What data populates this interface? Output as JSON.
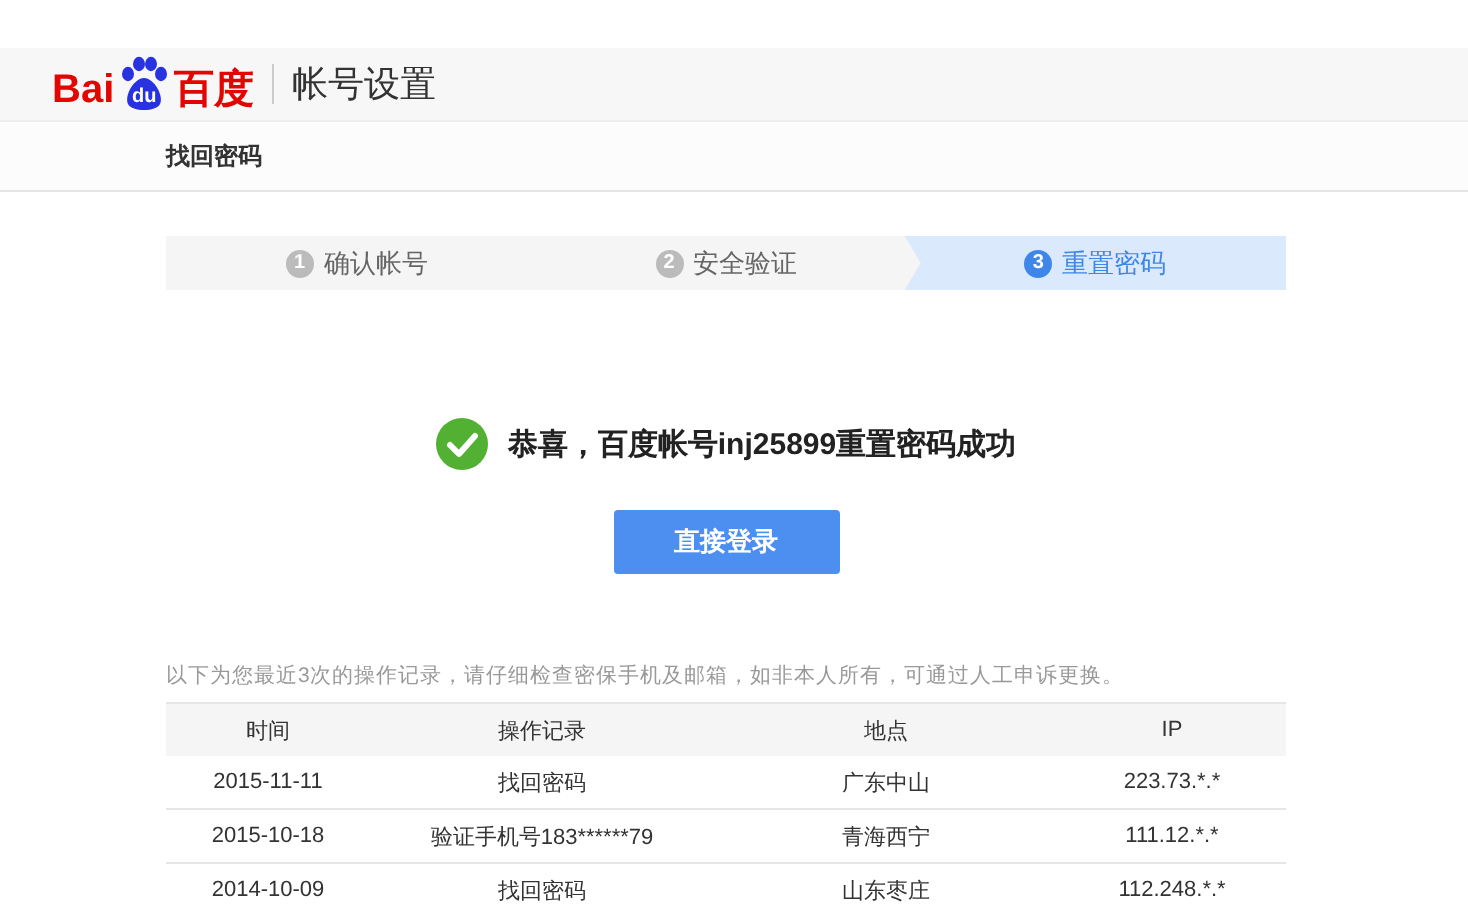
{
  "logo": {
    "left": "Bai",
    "paw": "du",
    "right": "百度"
  },
  "header": {
    "title": "帐号设置"
  },
  "breadcrumb": "找回密码",
  "steps": [
    {
      "number": "1",
      "label": "确认帐号",
      "selected": false
    },
    {
      "number": "2",
      "label": "安全验证",
      "selected": false
    },
    {
      "number": "3",
      "label": "重置密码",
      "selected": true
    }
  ],
  "message": {
    "before": "恭喜，百度帐号",
    "account": "inj25899",
    "after": "重置密码成功"
  },
  "login_button": "直接登录",
  "note": "以下为您最近3次的操作记录，请仔细检查密保手机及邮箱，如非本人所有，可通过人工申诉更换。",
  "table": {
    "columns": [
      "时间",
      "操作记录",
      "地点",
      "IP"
    ],
    "rows": [
      [
        "2015-11-11",
        "找回密码",
        "广东中山",
        "223.73.*.*"
      ],
      [
        "2015-10-18",
        "验证手机号183******79",
        "青海西宁",
        "111.12.*.*"
      ],
      [
        "2014-10-09",
        "找回密码",
        "山东枣庄",
        "112.248.*.*"
      ]
    ]
  }
}
